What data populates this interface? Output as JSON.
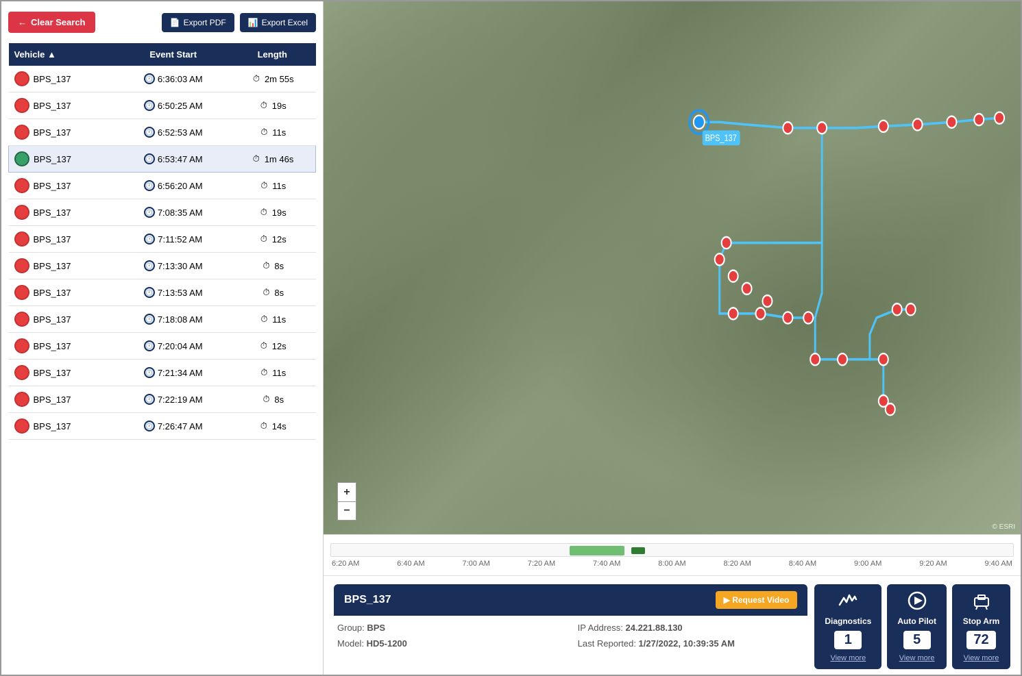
{
  "toolbar": {
    "clear_search_label": "Clear Search",
    "export_pdf_label": "Export PDF",
    "export_excel_label": "Export Excel"
  },
  "table": {
    "headers": [
      {
        "label": "Vehicle",
        "sort": "▲"
      },
      {
        "label": "Event Start",
        "sort": ""
      },
      {
        "label": "Length",
        "sort": ""
      }
    ],
    "rows": [
      {
        "id": 1,
        "vehicle": "BPS_137",
        "dot": "red",
        "selected": false,
        "time": "6:36:03 AM",
        "length": "2m 55s"
      },
      {
        "id": 2,
        "vehicle": "BPS_137",
        "dot": "red",
        "selected": false,
        "time": "6:50:25 AM",
        "length": "19s"
      },
      {
        "id": 3,
        "vehicle": "BPS_137",
        "dot": "red",
        "selected": false,
        "time": "6:52:53 AM",
        "length": "11s"
      },
      {
        "id": 4,
        "vehicle": "BPS_137",
        "dot": "green",
        "selected": true,
        "time": "6:53:47 AM",
        "length": "1m 46s"
      },
      {
        "id": 5,
        "vehicle": "BPS_137",
        "dot": "red",
        "selected": false,
        "time": "6:56:20 AM",
        "length": "11s"
      },
      {
        "id": 6,
        "vehicle": "BPS_137",
        "dot": "red",
        "selected": false,
        "time": "7:08:35 AM",
        "length": "19s"
      },
      {
        "id": 7,
        "vehicle": "BPS_137",
        "dot": "red",
        "selected": false,
        "time": "7:11:52 AM",
        "length": "12s"
      },
      {
        "id": 8,
        "vehicle": "BPS_137",
        "dot": "red",
        "selected": false,
        "time": "7:13:30 AM",
        "length": "8s"
      },
      {
        "id": 9,
        "vehicle": "BPS_137",
        "dot": "red",
        "selected": false,
        "time": "7:13:53 AM",
        "length": "8s"
      },
      {
        "id": 10,
        "vehicle": "BPS_137",
        "dot": "red",
        "selected": false,
        "time": "7:18:08 AM",
        "length": "11s"
      },
      {
        "id": 11,
        "vehicle": "BPS_137",
        "dot": "red",
        "selected": false,
        "time": "7:20:04 AM",
        "length": "12s"
      },
      {
        "id": 12,
        "vehicle": "BPS_137",
        "dot": "red",
        "selected": false,
        "time": "7:21:34 AM",
        "length": "11s"
      },
      {
        "id": 13,
        "vehicle": "BPS_137",
        "dot": "red",
        "selected": false,
        "time": "7:22:19 AM",
        "length": "8s"
      },
      {
        "id": 14,
        "vehicle": "BPS_137",
        "dot": "red",
        "selected": false,
        "time": "7:26:47 AM",
        "length": "14s"
      }
    ]
  },
  "map": {
    "zoom_in": "+",
    "zoom_out": "−",
    "esri_credit": "© ESRI"
  },
  "timeline": {
    "labels": [
      "6:20 AM",
      "6:40 AM",
      "7:00 AM",
      "7:20 AM",
      "7:40 AM",
      "8:00 AM",
      "8:20 AM",
      "8:40 AM",
      "9:00 AM",
      "9:20 AM",
      "9:40 AM"
    ]
  },
  "info": {
    "vehicle_name": "BPS_137",
    "request_video_label": "▶ Request Video",
    "group_label": "Group:",
    "group_value": "BPS",
    "ip_label": "IP Address:",
    "ip_value": "24.221.88.130",
    "model_label": "Model:",
    "model_value": "HD5-1200",
    "last_reported_label": "Last Reported:",
    "last_reported_value": "1/27/2022, 10:39:35 AM"
  },
  "actions": [
    {
      "id": "diagnostics",
      "icon": "📊",
      "label": "Diagnostics",
      "count": "1",
      "view_more": "View more"
    },
    {
      "id": "autopilot",
      "icon": "▶",
      "label": "Auto Pilot",
      "count": "5",
      "view_more": "View more"
    },
    {
      "id": "stoparm",
      "icon": "🚌",
      "label": "Stop Arm",
      "count": "72",
      "view_more": "View more"
    }
  ]
}
